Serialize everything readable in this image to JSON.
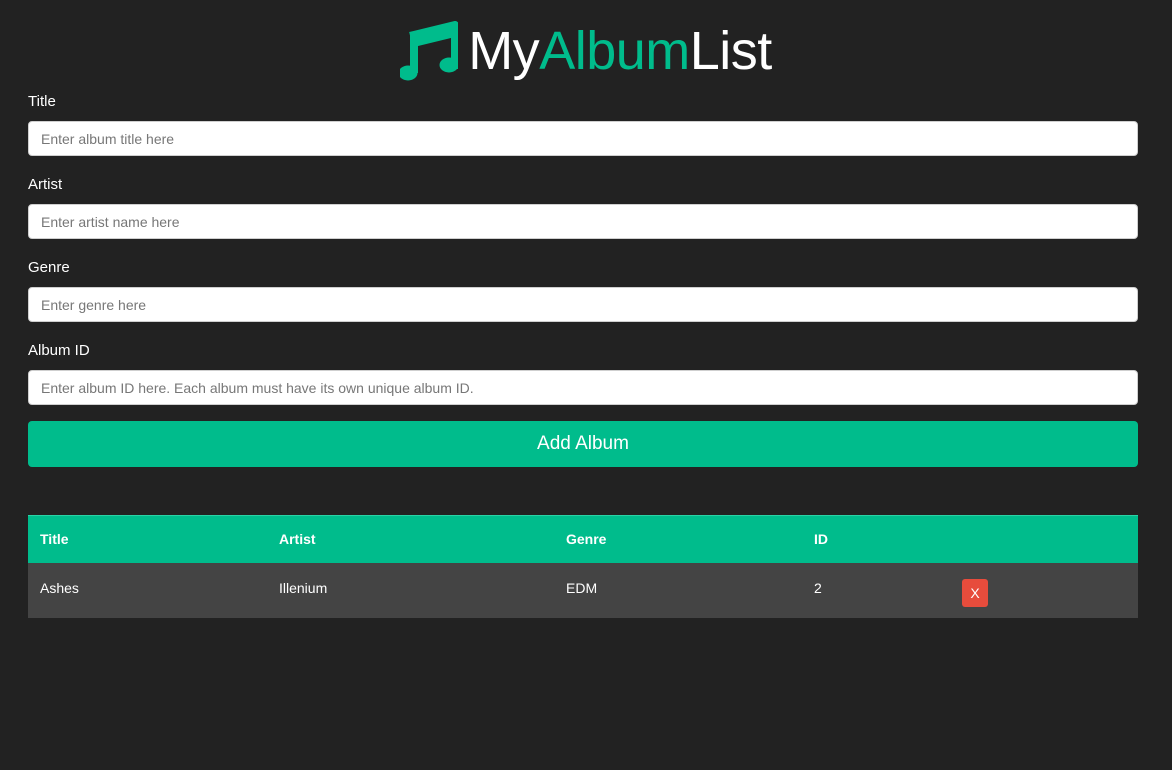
{
  "brand": {
    "part_my": "My",
    "part_album": "Album",
    "part_list": "List",
    "icon": "music-note-icon",
    "accent_color": "#00bc8c"
  },
  "form": {
    "title": {
      "label": "Title",
      "placeholder": "Enter album title here",
      "value": ""
    },
    "artist": {
      "label": "Artist",
      "placeholder": "Enter artist name here",
      "value": ""
    },
    "genre": {
      "label": "Genre",
      "placeholder": "Enter genre here",
      "value": ""
    },
    "album_id": {
      "label": "Album ID",
      "placeholder": "Enter album ID here. Each album must have its own unique album ID.",
      "value": ""
    },
    "submit_label": "Add Album"
  },
  "table": {
    "headers": [
      "Title",
      "Artist",
      "Genre",
      "ID",
      ""
    ],
    "rows": [
      {
        "title": "Ashes",
        "artist": "Illenium",
        "genre": "EDM",
        "id": "2",
        "delete_label": "X"
      }
    ]
  },
  "colors": {
    "background": "#222222",
    "accent": "#00bc8c",
    "row": "#444444",
    "danger": "#e74c3c"
  }
}
